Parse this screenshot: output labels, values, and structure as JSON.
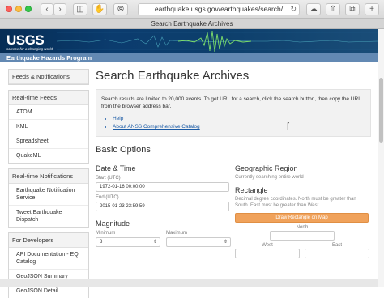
{
  "browser": {
    "url": "earthquake.usgs.gov/earthquakes/search/",
    "tab_title": "Search Earthquake Archives",
    "back_icon": "chevron-left-icon",
    "forward_icon": "chevron-right-icon"
  },
  "header": {
    "logo_text": "USGS",
    "tagline": "science for a changing world",
    "program": "Earthquake Hazards Program"
  },
  "sidebar": {
    "top_item": "Feeds & Notifications",
    "groups": [
      {
        "title": "Real-time Feeds",
        "items": [
          "ATOM",
          "KML",
          "Spreadsheet",
          "QuakeML"
        ]
      },
      {
        "title": "Real-time Notifications",
        "items": [
          "Earthquake Notification Service",
          "Tweet Earthquake Dispatch"
        ]
      },
      {
        "title": "For Developers",
        "items": [
          "API Documentation - EQ Catalog",
          "GeoJSON Summary",
          "GeoJSON Detail"
        ]
      }
    ]
  },
  "main": {
    "title": "Search Earthquake Archives",
    "info_text": "Search results are limited to 20,000 events. To get URL for a search, click the search button, then copy the URL from the browser address bar.",
    "links": [
      "Help",
      "About ANSS Comprehensive Catalog"
    ],
    "basic_options": "Basic Options",
    "datetime": {
      "heading": "Date & Time",
      "start_label": "Start (UTC)",
      "start_value": "1972-01-16 00:00:00",
      "end_label": "End (UTC)",
      "end_value": "2015-01-23 23:59:59"
    },
    "magnitude": {
      "heading": "Magnitude",
      "min_label": "Minimum",
      "min_value": "8",
      "max_label": "Maximum",
      "max_value": ""
    },
    "geo": {
      "heading": "Geographic Region",
      "status": "Currently searching entire world",
      "rect_heading": "Rectangle",
      "rect_note": "Decimal degree coordinates. North must be greater than South. East must be greater than West.",
      "draw_button": "Draw Rectangle on Map",
      "north": "North",
      "west": "West",
      "east": "East"
    }
  }
}
